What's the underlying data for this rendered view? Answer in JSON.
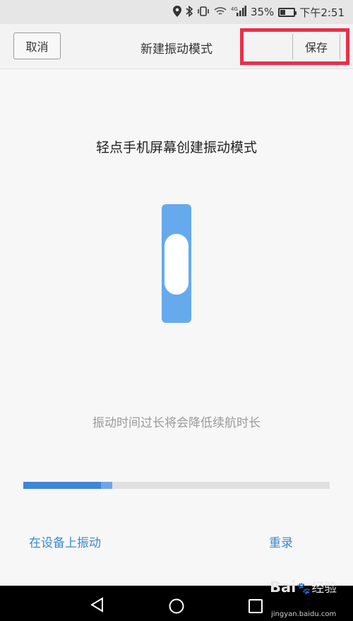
{
  "status_bar": {
    "battery_percent": "35%",
    "time": "下午2:51",
    "network": "4G"
  },
  "header": {
    "cancel_label": "取消",
    "title": "新建振动模式",
    "save_label": "保存"
  },
  "main": {
    "instruction": "轻点手机屏幕创建振动模式",
    "warning": "振动时间过长将会降低续航时长",
    "progress": 0.29,
    "vibrate_on_device_label": "在设备上振动",
    "rerecord_label": "重录"
  },
  "colors": {
    "accent": "#3b88d0",
    "band": "#66aaed",
    "highlight": "#e8304a"
  },
  "watermark": {
    "brand_left": "Bai",
    "brand_right": "经验",
    "url": "jingyan.baidu.com"
  }
}
